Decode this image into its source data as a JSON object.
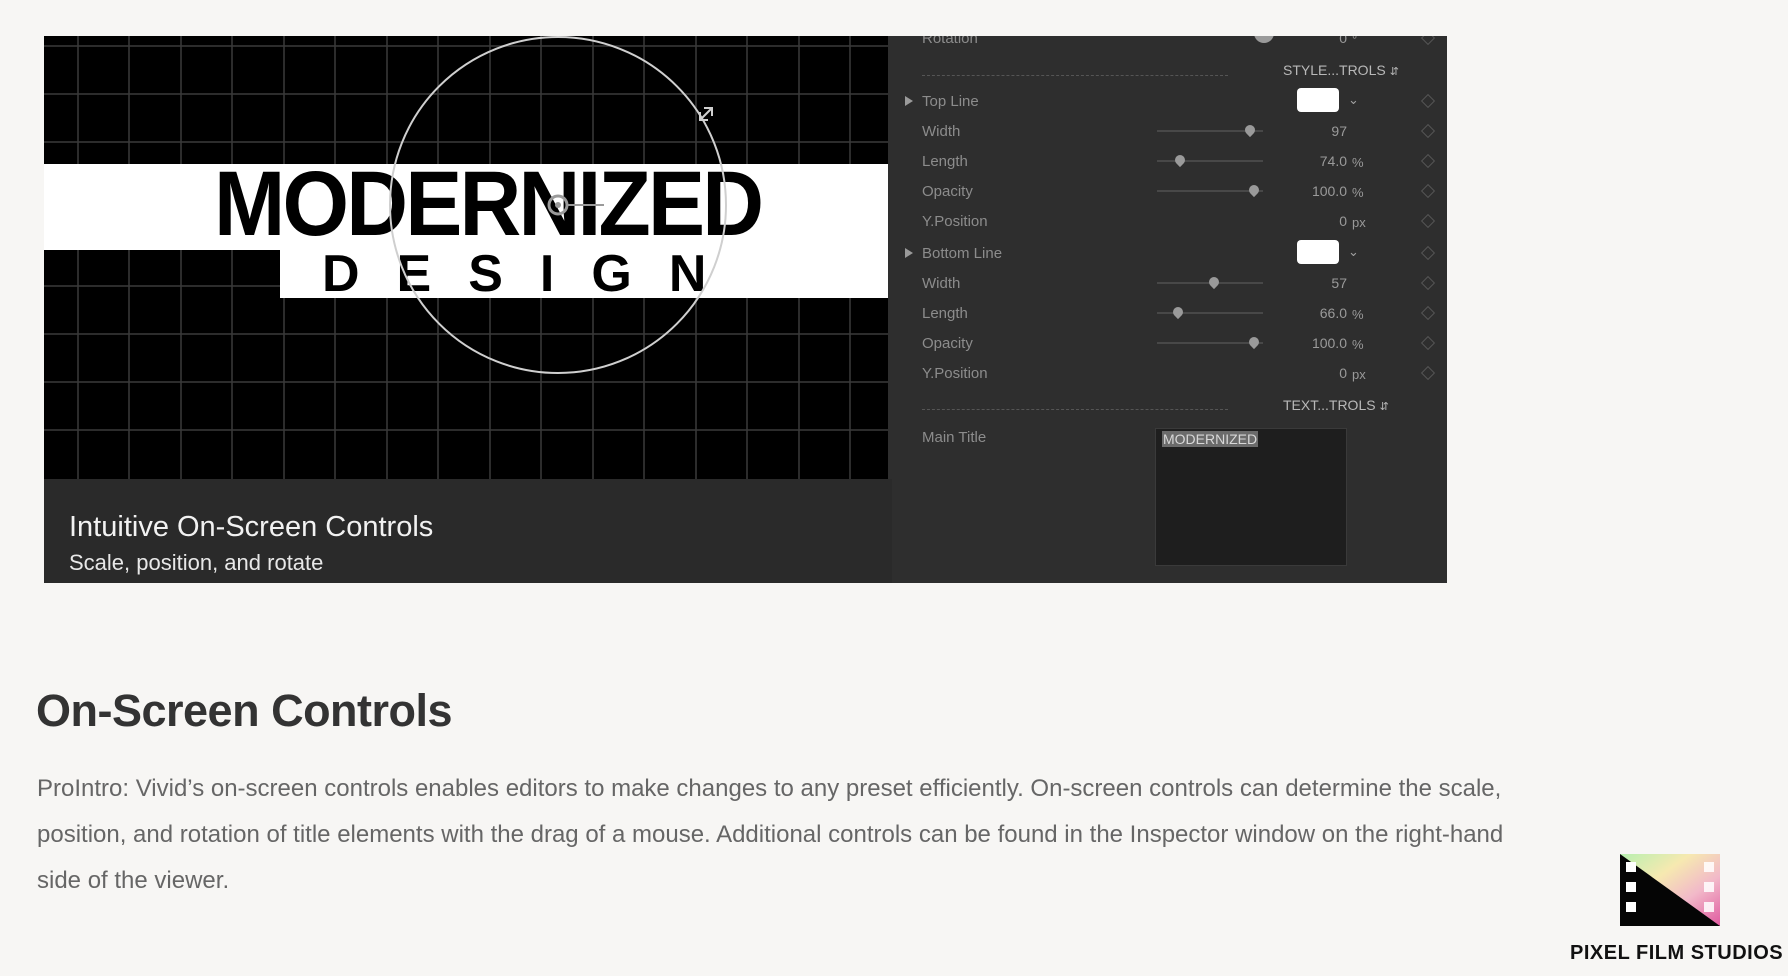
{
  "viewer": {
    "headline": "MODERNIZED",
    "subline": "DESIGN",
    "caption_title": "Intuitive On-Screen Controls",
    "caption_subtitle": "Scale, position, and rotate"
  },
  "inspector": {
    "rotation": {
      "label": "Rotation",
      "value": "0",
      "unit": "°"
    },
    "style_group": "STYLE...TROLS",
    "top_line": {
      "label": "Top Line",
      "color": "#ffffff",
      "params": [
        {
          "label": "Width",
          "value": "97",
          "unit": "",
          "fraction": 0.88
        },
        {
          "label": "Length",
          "value": "74.0",
          "unit": "%",
          "fraction": 0.18
        },
        {
          "label": "Opacity",
          "value": "100.0",
          "unit": "%",
          "fraction": 0.92
        },
        {
          "label": "Y.Position",
          "value": "0",
          "unit": "px"
        }
      ]
    },
    "bottom_line": {
      "label": "Bottom Line",
      "color": "#ffffff",
      "params": [
        {
          "label": "Width",
          "value": "57",
          "unit": "",
          "fraction": 0.52
        },
        {
          "label": "Length",
          "value": "66.0",
          "unit": "%",
          "fraction": 0.16
        },
        {
          "label": "Opacity",
          "value": "100.0",
          "unit": "%",
          "fraction": 0.92
        },
        {
          "label": "Y.Position",
          "value": "0",
          "unit": "px"
        }
      ]
    },
    "text_group": "TEXT...TROLS",
    "main_title": {
      "label": "Main Title",
      "value": "MODERNIZED"
    }
  },
  "article": {
    "heading": "On-Screen Controls",
    "body": "ProIntro: Vivid’s on-screen controls enables editors to make changes to any preset efficiently. On-screen controls can determine the scale, position, and rotation of title elements with the drag of a mouse. Additional controls can be found in the Inspector window on the right-hand side of the viewer."
  },
  "logo": {
    "brand": "PIXEL FILM STUDIOS"
  },
  "icons": [
    "rotation-knob-icon",
    "disclosure-triangle-icon",
    "keyframe-diamond-icon",
    "chevron-down-icon",
    "updown-arrows-icon",
    "resize-handle-icon",
    "film-strip-logo-icon"
  ]
}
